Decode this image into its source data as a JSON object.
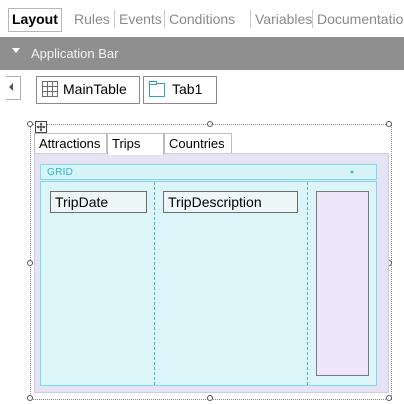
{
  "editor_tabs": [
    "Layout",
    "Rules",
    "Events",
    "Conditions",
    "Variables",
    "Documentation"
  ],
  "app_bar": {
    "label": "Application Bar"
  },
  "breadcrumbs": [
    {
      "label": "MainTable",
      "icon": "table-grid-icon"
    },
    {
      "label": "Tab1",
      "icon": "tab-icon"
    }
  ],
  "form": {
    "tabs": [
      "Attractions",
      "Trips",
      "Countries"
    ],
    "selected_tab": "Trips",
    "grid": {
      "label": "GRID",
      "columns": [
        "TripDate",
        "TripDescription"
      ]
    }
  },
  "colors": {
    "app_bar": "#8f8f8f",
    "tab_panel": "#e6e3f4",
    "grid_fill": "#dcf5f8",
    "grid_border": "#7fd9e6",
    "grid_label": "#2cb8c8"
  }
}
